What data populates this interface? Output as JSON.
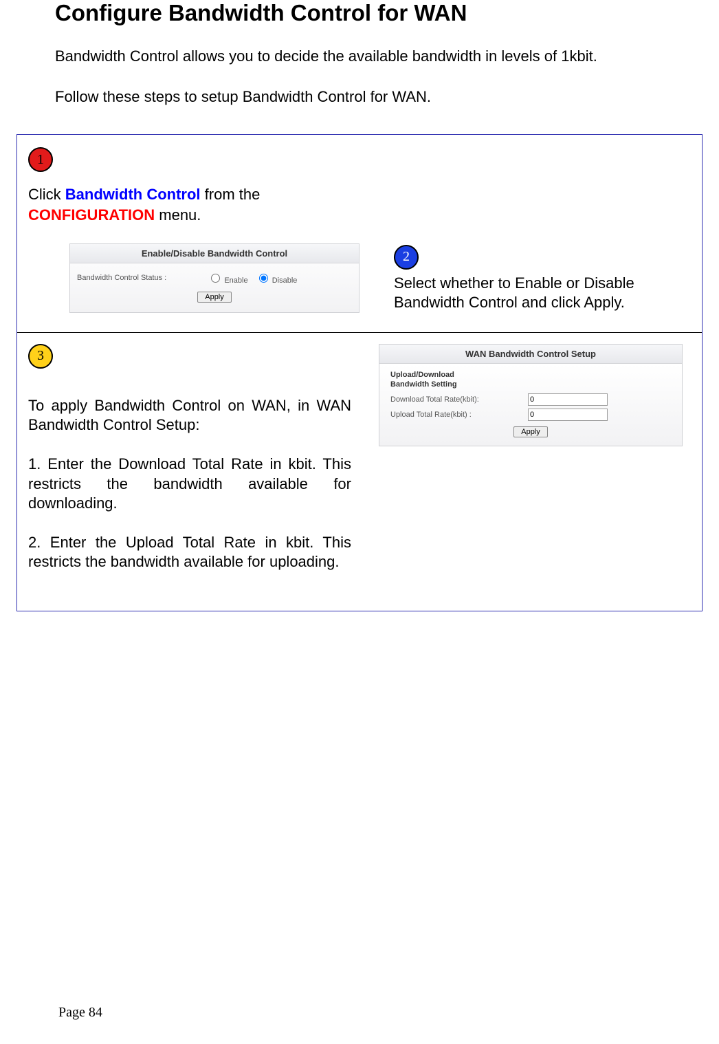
{
  "title": "Configure Bandwidth Control for WAN",
  "intro1": "Bandwidth Control allows you to decide the available bandwidth in levels of 1kbit.",
  "intro2": "Follow these steps to setup Bandwidth Control for WAN.",
  "step_numbers": {
    "s1": "1",
    "s2": "2",
    "s3": "3"
  },
  "step1": {
    "pre": "Click ",
    "link1": "Bandwidth Control",
    "mid": " from the ",
    "link2": "CONFIGURATION",
    "post": " menu."
  },
  "panel1": {
    "heading": "Enable/Disable Bandwidth Control",
    "status_label": "Bandwidth Control Status :",
    "enable_label": "Enable",
    "disable_label": "Disable",
    "selected": "disable",
    "apply": "Apply"
  },
  "step2_text": "Select whether to Enable or Disable Bandwidth Control and click Apply.",
  "step3": {
    "lead": "To apply Bandwidth Control on WAN, in WAN Bandwidth Control Setup:",
    "p1": "1. Enter the Download Total Rate in kbit. This restricts the bandwidth available for downloading.",
    "p2": "2. Enter the Upload Total Rate in kbit. This restricts the bandwidth available for uploading."
  },
  "panel2": {
    "heading": "WAN Bandwidth Control Setup",
    "subhead": "Upload/Download Bandwidth Setting",
    "download_label": "Download Total Rate(kbit):",
    "upload_label": "Upload Total Rate(kbit) :",
    "download_value": "0",
    "upload_value": "0",
    "apply": "Apply"
  },
  "page_number": "Page 84"
}
